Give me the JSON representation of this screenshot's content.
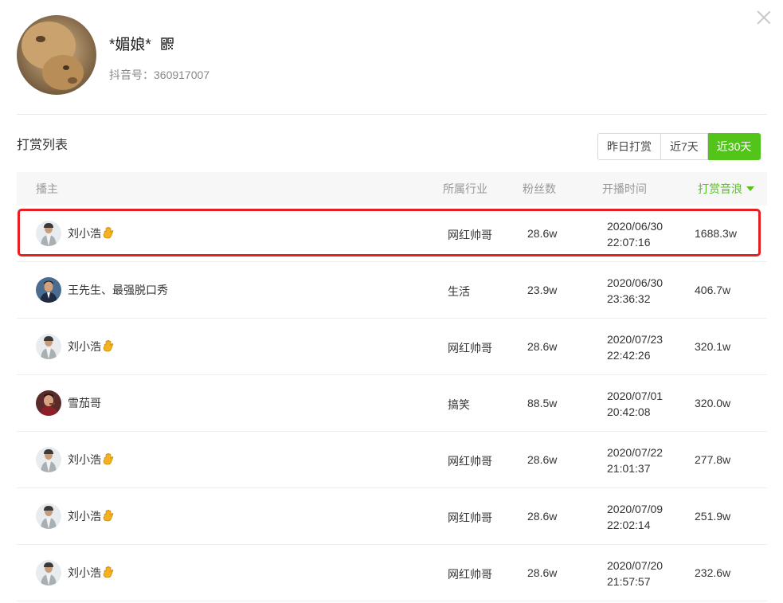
{
  "profile": {
    "name": "*媚娘*",
    "id_text": "抖音号：360917007"
  },
  "section_title": "打赏列表",
  "tabs": [
    {
      "label": "昨日打赏",
      "active": false
    },
    {
      "label": "近7天",
      "active": false
    },
    {
      "label": "近30天",
      "active": true
    }
  ],
  "table": {
    "headers": {
      "anchor": "播主",
      "industry": "所属行业",
      "fans": "粉丝数",
      "time": "开播时间",
      "reward": "打赏音浪"
    },
    "rows": [
      {
        "name": "刘小浩",
        "hand_icon": true,
        "avatar": "avatar-grey-jacket",
        "industry": "网红帅哥",
        "fans": "28.6w",
        "date": "2020/06/30",
        "time": "22:07:16",
        "reward": "1688.3w"
      },
      {
        "name": "王先生、最强脱口秀",
        "hand_icon": false,
        "avatar": "avatar-suit",
        "industry": "生活",
        "fans": "23.9w",
        "date": "2020/06/30",
        "time": "23:36:32",
        "reward": "406.7w"
      },
      {
        "name": "刘小浩",
        "hand_icon": true,
        "avatar": "avatar-grey-jacket",
        "industry": "网红帅哥",
        "fans": "28.6w",
        "date": "2020/07/23",
        "time": "22:42:26",
        "reward": "320.1w"
      },
      {
        "name": "雪茄哥",
        "hand_icon": false,
        "avatar": "avatar-cigar",
        "industry": "搞笑",
        "fans": "88.5w",
        "date": "2020/07/01",
        "time": "20:42:08",
        "reward": "320.0w"
      },
      {
        "name": "刘小浩",
        "hand_icon": true,
        "avatar": "avatar-grey-jacket",
        "industry": "网红帅哥",
        "fans": "28.6w",
        "date": "2020/07/22",
        "time": "21:01:37",
        "reward": "277.8w"
      },
      {
        "name": "刘小浩",
        "hand_icon": true,
        "avatar": "avatar-grey-jacket",
        "industry": "网红帅哥",
        "fans": "28.6w",
        "date": "2020/07/09",
        "time": "22:02:14",
        "reward": "251.9w"
      },
      {
        "name": "刘小浩",
        "hand_icon": true,
        "avatar": "avatar-grey-jacket",
        "industry": "网红帅哥",
        "fans": "28.6w",
        "date": "2020/07/20",
        "time": "21:57:57",
        "reward": "232.6w"
      }
    ]
  },
  "colors": {
    "accent": "#52c41a",
    "highlight": "#e62020"
  }
}
